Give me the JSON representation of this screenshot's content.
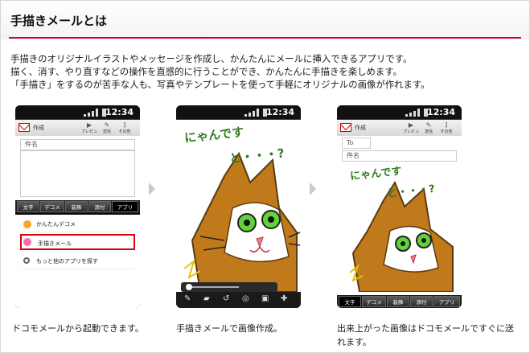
{
  "section": {
    "title": "手描きメールとは",
    "intro": [
      "手描きのオリジナルイラストやメッセージを作成し、かんたんにメールに挿入できるアプリです。",
      "描く、消す、やり直すなどの操作を直感的に行うことができ、かんたんに手描きを楽しめます。",
      "「手描き」をするのが苦手な人も、写真やテンプレートを使って手軽にオリジナルの画像が作れます。"
    ]
  },
  "status": {
    "time": "12:34"
  },
  "screens": [
    {
      "toolbar": {
        "title": "作成",
        "preview": "プレビュー",
        "send": "送信",
        "other": "その他"
      },
      "subject_placeholder": "件名",
      "tabs": [
        "文字",
        "デコメ",
        "装飾",
        "添付",
        "アプリ"
      ],
      "menu": [
        "かんたんデコメ",
        "手描きメール",
        "もっと他のアプリを探す"
      ],
      "caption": "ドコモメールから起動できます。"
    },
    {
      "handwriting": [
        "にゃんです",
        "と・・・?"
      ],
      "caption": "手描きメールで画像作成。"
    },
    {
      "toolbar": {
        "title": "作成",
        "preview": "プレビュー",
        "send": "送信",
        "other": "その他"
      },
      "to_label": "To",
      "subject_placeholder": "件名",
      "handwriting": [
        "にゃんです",
        "と・・・?"
      ],
      "tabs": [
        "文字",
        "デコメ",
        "装飾",
        "添付",
        "アプリ"
      ],
      "caption": "出来上がった画像はドコモメールですぐに送れます。"
    }
  ],
  "colors": {
    "accent_rule": "#d4003a",
    "highlight": "#e00014",
    "handwriting": "#2f7d1e",
    "cat_orange": "#c07a1c"
  }
}
